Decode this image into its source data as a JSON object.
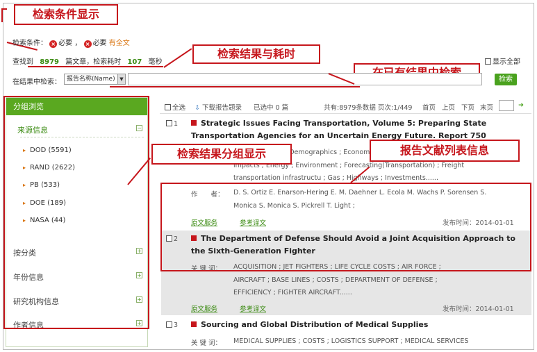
{
  "callouts": {
    "condition": "检索条件显示",
    "result_time": "检索结果与耗时",
    "within": "在已有结果中检索",
    "group": "检索结果分组显示",
    "list": "报告文献列表信息"
  },
  "conditions": {
    "label": "检索条件：",
    "req1": "必要",
    "req2": "必要",
    "fulltext": "有全文"
  },
  "summary": {
    "found_prefix": "查找到",
    "count": "8979",
    "mid": "篇文章，检索耗时",
    "time": "107",
    "unit": "毫秒"
  },
  "show_all": "显示全部",
  "within_search": {
    "label": "在结果中检索：",
    "field": "报告名称(Name)",
    "button": "检索"
  },
  "sidebar": {
    "title": "分组浏览",
    "source_title": "来源信息",
    "sources": [
      "DOD (5591)",
      "RAND (2622)",
      "PB (533)",
      "DOE (189)",
      "NASA (44)"
    ],
    "groups": [
      "按分类",
      "年份信息",
      "研究机构信息",
      "作者信息"
    ]
  },
  "toolbar": {
    "select_all": "全选",
    "download": "下载报告题录",
    "selected": "已选中 0 篇",
    "pager": "共有:8979条数据 页次:1/449",
    "first": "首页",
    "prev": "上页",
    "next": "下页",
    "last": "末页"
  },
  "results": [
    {
      "num": "1",
      "title1": "Strategic Issues Facing Transportation, Volume 5: Preparing State",
      "title2": "Transportation Agencies for an Uncertain Energy Future. Report 750",
      "kw1": "; Demographics ; Economic",
      "kw2": "impacts ; Energy ; Environment ; Forecasting(Transportation) ; Freight",
      "kw3": "transportation infrastructu ; Gas ; Highways ; Investments......",
      "author_label": "作　　者：",
      "authors1": "D. S. Ortiz E. Enarson-Hering E. M. Daehner L. Ecola M. Wachs P. Sorensen S.",
      "authors2": "Monica S. Monica S. Pickrell T. Light ;",
      "link1": "原文服务",
      "link2": "参考译文",
      "date": "发布时间：2014-01-01"
    },
    {
      "num": "2",
      "title1": "The Department of Defense Should Avoid a Joint Acquisition Approach to",
      "title2": "the Sixth-Generation Fighter",
      "kw_label": "关 键 词：",
      "kw1": "ACQUISITION ; JET FIGHTERS ; LIFE CYCLE COSTS ; AIR FORCE ;",
      "kw2": "AIRCRAFT ; BASE LINES ; COSTS ; DEPARTMENT OF DEFENSE ;",
      "kw3": "EFFICIENCY ; FIGHTER AIRCRAFT......",
      "link1": "原文服务",
      "link2": "参考译文",
      "date": "发布时间：2014-01-01"
    },
    {
      "num": "3",
      "title1": "Sourcing and Global Distribution of Medical Supplies",
      "kw_label": "关 键 词：",
      "kw1": "MEDICAL SUPPLIES ; COSTS ; LOGISTICS SUPPORT ; MEDICAL SERVICES"
    }
  ]
}
